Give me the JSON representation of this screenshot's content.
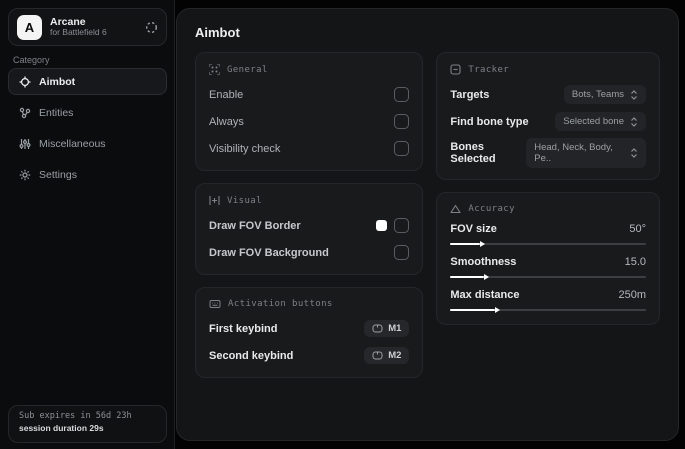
{
  "app": {
    "logo_letter": "A",
    "name": "Arcane",
    "subtitle": "for Battlefield 6"
  },
  "sidebar": {
    "category_label": "Category",
    "items": [
      {
        "label": "Aimbot",
        "active": true
      },
      {
        "label": "Entities",
        "active": false
      },
      {
        "label": "Miscellaneous",
        "active": false
      },
      {
        "label": "Settings",
        "active": false
      }
    ],
    "footer": {
      "expiry": "Sub expires in 56d 23h",
      "session": "session duration 29s"
    }
  },
  "main": {
    "title": "Aimbot",
    "general": {
      "title": "General",
      "rows": [
        {
          "label": "Enable",
          "checked": false
        },
        {
          "label": "Always",
          "checked": false
        },
        {
          "label": "Visibility check",
          "checked": false
        }
      ]
    },
    "visual": {
      "title": "Visual",
      "rows": [
        {
          "label": "Draw FOV Border",
          "swatch": "#ffffff",
          "checked": false
        },
        {
          "label": "Draw FOV Background",
          "checked": false
        }
      ]
    },
    "activation": {
      "title": "Activation buttons",
      "rows": [
        {
          "label": "First keybind",
          "key": "M1"
        },
        {
          "label": "Second keybind",
          "key": "M2"
        }
      ]
    },
    "tracker": {
      "title": "Tracker",
      "rows": [
        {
          "label": "Targets",
          "value": "Bots, Teams"
        },
        {
          "label": "Find bone type",
          "value": "Selected bone"
        },
        {
          "label": "Bones Selected",
          "value": "Head, Neck, Body, Pe.."
        }
      ]
    },
    "accuracy": {
      "title": "Accuracy",
      "sliders": [
        {
          "label": "FOV size",
          "value": "50°",
          "percent": "15%"
        },
        {
          "label": "Smoothness",
          "value": "15.0",
          "percent": "17%"
        },
        {
          "label": "Max distance",
          "value": "250m",
          "percent": "23%"
        }
      ]
    }
  },
  "colors": {
    "accent": "#ffffff",
    "panel": "#141517",
    "card": "#191a1c"
  }
}
